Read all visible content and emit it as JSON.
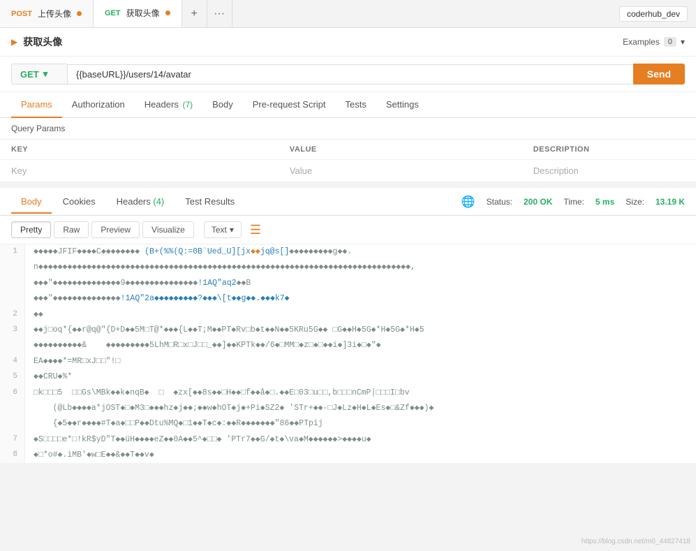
{
  "tabs": [
    {
      "method": "POST",
      "label": "上传头像",
      "dot": true,
      "active": false
    },
    {
      "method": "GET",
      "label": "获取头像",
      "dot": true,
      "active": true
    }
  ],
  "env": "coderhub_dev",
  "request": {
    "collapse_arrow": "▶",
    "title": "获取头像",
    "examples_label": "Examples",
    "examples_count": "0"
  },
  "url_bar": {
    "method": "GET",
    "url_base": "{{baseURL}}",
    "url_path": "/users/14/avatar",
    "send_label": "Send"
  },
  "nav_tabs": [
    {
      "label": "Params",
      "active": true,
      "badge": null
    },
    {
      "label": "Authorization",
      "active": false,
      "badge": null
    },
    {
      "label": "Headers",
      "active": false,
      "badge": "(7)"
    },
    {
      "label": "Body",
      "active": false,
      "badge": null
    },
    {
      "label": "Pre-request Script",
      "active": false,
      "badge": null
    },
    {
      "label": "Tests",
      "active": false,
      "badge": null
    },
    {
      "label": "Settings",
      "active": false,
      "badge": null
    }
  ],
  "query_params": {
    "section_label": "Query Params",
    "columns": [
      "KEY",
      "VALUE",
      "DESCRIPTION"
    ],
    "placeholder_key": "Key",
    "placeholder_value": "Value",
    "placeholder_desc": "Description"
  },
  "response": {
    "tabs": [
      {
        "label": "Body",
        "active": true,
        "badge": null
      },
      {
        "label": "Cookies",
        "active": false,
        "badge": null
      },
      {
        "label": "Headers",
        "active": false,
        "badge": "(4)"
      },
      {
        "label": "Test Results",
        "active": false,
        "badge": null
      }
    ],
    "status": "200 OK",
    "time": "5 ms",
    "size": "13.19 K",
    "status_label": "Status:",
    "time_label": "Time:",
    "size_label": "Size:"
  },
  "format_bar": {
    "buttons": [
      "Pretty",
      "Raw",
      "Preview",
      "Visualize"
    ],
    "active_btn": "Pretty",
    "text_dropdown": "Text",
    "wrap_icon": "≡"
  },
  "code_lines": [
    {
      "num": 1,
      "content": "����JFIF������C������(B+(%%(Q:=0B`Ued_U][jx��jq@s[]���g��n���"
    },
    {
      "num": "",
      "content": "n�����������������������������������,"
    },
    {
      "num": "",
      "content": "����\"�����������������9���������!1AQ\"aq2��B"
    },
    {
      "num": "",
      "content": "����\"�����������������!1AQ\"2a���������?���\\[t��g��.���k7�"
    },
    {
      "num": 2,
      "content": "��"
    },
    {
      "num": 3,
      "content": "��j□oq*{��r@q@\"{D+D��5M□T@*@@@{L@@T;M@@PT@Rv□b@t@@N@@5KRu5G@@ □G@@H@5G@*H@5G@*H@5"
    },
    {
      "num": "",
      "content": "����������&    ����������5LhM□R□x□J□□_@@]@@KPTk@@/6@□MM□@z□@□@@i@]3i@□@\"@"
    },
    {
      "num": 4,
      "content": "EA����*=MR□xJ□□\"!□"
    },
    {
      "num": 5,
      "content": "@@CRU@%*"
    },
    {
      "num": 6,
      "content": "□k□□□5  □□Gs\\MBk@@k@nqB@  □  @zx[@@8s@@□H@@□f@@å@□.@@E□03□u□□,b□□□nCmP|□□□I□bv"
    },
    {
      "num": "",
      "content": "    (@Lb@@@@a*jOST@□@M3□@@@hz@j@@;@@w@hOT@j@+Pi@SZ2@ 'STr+@@-□J@Lz@H@L@Es@□&Zf@@@)@"
    },
    {
      "num": "",
      "content": "    {@5@@r@@@@#T@a@□□P@@Dtu%MQ@□1@@T@c@:@@R@������\"86@@PTpij"
    },
    {
      "num": 7,
      "content": "@S□□□□e*□!kR$yD\"T@@üH@@@@eZ@@0A@@5^@□□@ 'PTr7@@G/@t@\\va@M@@@@@>@@@@u@"
    },
    {
      "num": 8,
      "content": "@□*o#@.iMB'@w□E@@&@@T@@v@"
    }
  ],
  "watermark": "https://blog.csdn.net/m0_44827418"
}
